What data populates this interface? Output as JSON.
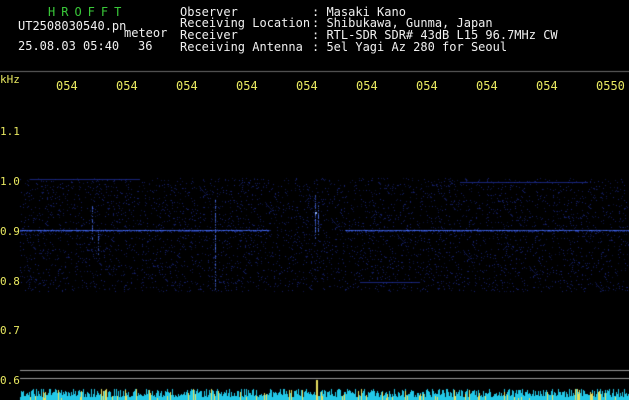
{
  "header": {
    "brand": "HROFFT",
    "file_name": "UT2508030540.pn",
    "mode": "meteor",
    "date_time": "25.08.03 05:40",
    "count": "36",
    "observer_label": "Observer",
    "observer_value": ": Masaki Kano",
    "location_label": "Receiving Location",
    "location_value": ": Shibukawa, Gunma, Japan",
    "receiver_label": "Receiver",
    "receiver_value": ": RTL-SDR SDR# 43dB L15 96.7MHz CW",
    "antenna_label": "Receiving Antenna",
    "antenna_value": ": 5el Yagi Az 280 for Seoul"
  },
  "axes": {
    "y_unit": "kHz",
    "x_ticks": [
      "054",
      "054",
      "054",
      "054",
      "054",
      "054",
      "054",
      "054",
      "054",
      "0550"
    ],
    "y_ticks": [
      "1.1",
      "1.0",
      "0.9",
      "0.8",
      "0.7",
      "0.6"
    ]
  },
  "colors": {
    "text_yellow": "#e8e860",
    "text_white": "#f0f0f0",
    "brand_green": "#39c839",
    "signal_blue": "#3a4cff",
    "noise_cyan": "#22c8e8",
    "background": "#000000"
  }
}
